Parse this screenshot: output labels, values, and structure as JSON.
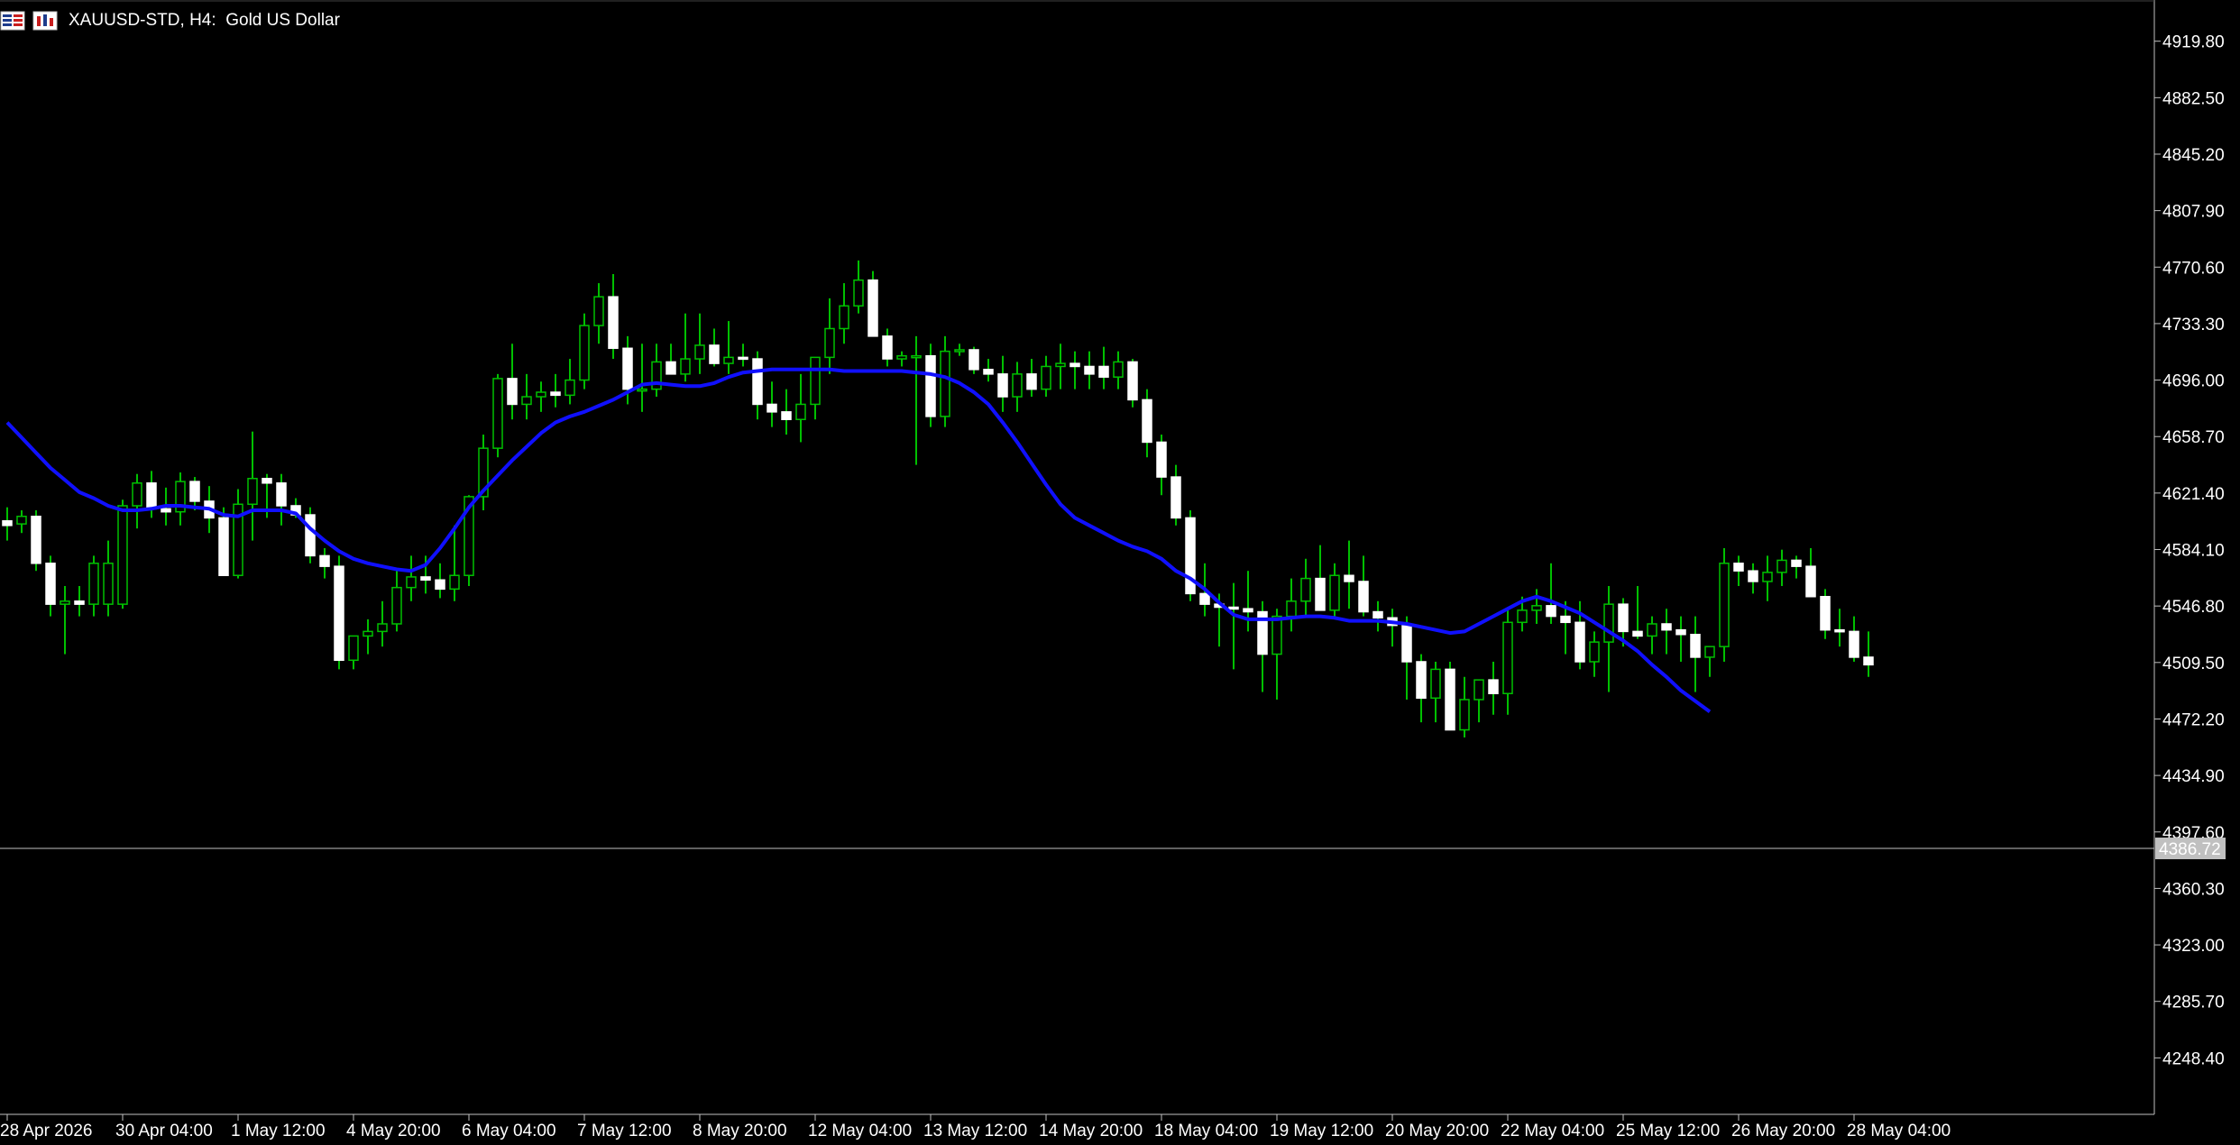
{
  "window": {
    "symbol": "XAUUSD-STD",
    "timeframe": "H4:",
    "description": "Gold US Dollar"
  },
  "icons": {
    "menu": "window-menu-icon",
    "chart": "chart-type-icon"
  },
  "colors": {
    "background": "#000000",
    "axis": "#c0c0c0",
    "bull_candle_body": "#000000",
    "bear_candle_body": "#ffffff",
    "wick": "#00c000",
    "ma_line": "#1010ff",
    "price_line": "#808080",
    "price_label_bg": "#c0c0c0",
    "text": "#ffffff"
  },
  "current_price": {
    "value": 4386.72,
    "label": "4386.72"
  },
  "chart_data": {
    "type": "candlestick",
    "symbol": "XAUUSD-STD",
    "timeframe": "H4",
    "ylim": [
      4211.1,
      4947.0
    ],
    "y_ticks": [
      "4919.80",
      "4882.50",
      "4845.20",
      "4807.90",
      "4770.60",
      "4733.30",
      "4696.00",
      "4658.70",
      "4621.40",
      "4584.10",
      "4546.80",
      "4509.50",
      "4472.20",
      "4434.90",
      "4397.60",
      "4360.30",
      "4323.00",
      "4285.70",
      "4248.40"
    ],
    "x_labels": [
      "28 Apr 2026",
      "30 Apr 04:00",
      "1 May 12:00",
      "4 May 20:00",
      "6 May 04:00",
      "7 May 12:00",
      "8 May 20:00",
      "12 May 04:00",
      "13 May 12:00",
      "14 May 20:00",
      "18 May 04:00",
      "19 May 12:00",
      "20 May 20:00",
      "22 May 04:00",
      "25 May 12:00",
      "26 May 20:00",
      "28 May 04:00"
    ],
    "x_label_bar_index": [
      0,
      8,
      16,
      24,
      32,
      40,
      48,
      56,
      64,
      72,
      80,
      88,
      96,
      104,
      112,
      120,
      128
    ],
    "candles": [
      [
        4603,
        4612,
        4590,
        4600
      ],
      [
        4601,
        4610,
        4595,
        4606
      ],
      [
        4606,
        4610,
        4570,
        4575
      ],
      [
        4575,
        4580,
        4540,
        4548
      ],
      [
        4548,
        4560,
        4515,
        4550
      ],
      [
        4550,
        4560,
        4540,
        4548
      ],
      [
        4548,
        4580,
        4540,
        4575
      ],
      [
        4548,
        4590,
        4540,
        4575
      ],
      [
        4548,
        4617,
        4545,
        4613
      ],
      [
        4613,
        4634,
        4598,
        4628
      ],
      [
        4628,
        4636,
        4605,
        4611
      ],
      [
        4611,
        4625,
        4600,
        4609
      ],
      [
        4609,
        4635,
        4600,
        4629
      ],
      [
        4629,
        4632,
        4610,
        4616
      ],
      [
        4616,
        4626,
        4595,
        4605
      ],
      [
        4605,
        4612,
        4570,
        4567
      ],
      [
        4567,
        4624,
        4565,
        4614
      ],
      [
        4614,
        4662,
        4590,
        4631
      ],
      [
        4631,
        4634,
        4605,
        4628
      ],
      [
        4628,
        4634,
        4600,
        4613
      ],
      [
        4613,
        4618,
        4605,
        4607
      ],
      [
        4607,
        4612,
        4575,
        4580
      ],
      [
        4580,
        4585,
        4565,
        4573
      ],
      [
        4573,
        4580,
        4505,
        4511
      ],
      [
        4511,
        4520,
        4505,
        4527
      ],
      [
        4527,
        4538,
        4515,
        4530
      ],
      [
        4530,
        4550,
        4520,
        4535
      ],
      [
        4535,
        4570,
        4530,
        4559
      ],
      [
        4559,
        4580,
        4550,
        4566
      ],
      [
        4566,
        4580,
        4555,
        4564
      ],
      [
        4564,
        4575,
        4552,
        4558
      ],
      [
        4558,
        4600,
        4550,
        4567
      ],
      [
        4567,
        4620,
        4560,
        4619
      ],
      [
        4619,
        4660,
        4610,
        4651
      ],
      [
        4651,
        4700,
        4645,
        4697
      ],
      [
        4697,
        4720,
        4670,
        4680
      ],
      [
        4680,
        4700,
        4670,
        4685
      ],
      [
        4685,
        4695,
        4675,
        4688
      ],
      [
        4688,
        4700,
        4678,
        4686
      ],
      [
        4686,
        4710,
        4680,
        4696
      ],
      [
        4696,
        4740,
        4690,
        4732
      ],
      [
        4732,
        4760,
        4720,
        4751
      ],
      [
        4751,
        4766,
        4710,
        4717
      ],
      [
        4717,
        4725,
        4680,
        4690
      ],
      [
        4690,
        4720,
        4675,
        4690
      ],
      [
        4690,
        4720,
        4685,
        4708
      ],
      [
        4708,
        4720,
        4700,
        4700
      ],
      [
        4700,
        4740,
        4695,
        4710
      ],
      [
        4710,
        4740,
        4700,
        4719
      ],
      [
        4719,
        4730,
        4705,
        4707
      ],
      [
        4707,
        4735,
        4700,
        4711
      ],
      [
        4711,
        4720,
        4705,
        4710
      ],
      [
        4710,
        4715,
        4670,
        4680
      ],
      [
        4680,
        4695,
        4665,
        4675
      ],
      [
        4675,
        4690,
        4660,
        4670
      ],
      [
        4670,
        4700,
        4655,
        4680
      ],
      [
        4680,
        4700,
        4670,
        4711
      ],
      [
        4711,
        4750,
        4700,
        4730
      ],
      [
        4730,
        4760,
        4720,
        4745
      ],
      [
        4745,
        4775,
        4740,
        4762
      ],
      [
        4762,
        4768,
        4725,
        4725
      ],
      [
        4725,
        4730,
        4705,
        4710
      ],
      [
        4710,
        4715,
        4705,
        4712
      ],
      [
        4712,
        4725,
        4640,
        4712
      ],
      [
        4712,
        4720,
        4665,
        4672
      ],
      [
        4672,
        4725,
        4665,
        4715
      ],
      [
        4715,
        4720,
        4712,
        4716
      ],
      [
        4716,
        4718,
        4700,
        4703
      ],
      [
        4703,
        4710,
        4695,
        4700
      ],
      [
        4700,
        4712,
        4675,
        4685
      ],
      [
        4685,
        4708,
        4675,
        4700
      ],
      [
        4700,
        4710,
        4685,
        4690
      ],
      [
        4690,
        4712,
        4685,
        4705
      ],
      [
        4705,
        4720,
        4690,
        4707
      ],
      [
        4707,
        4715,
        4690,
        4705
      ],
      [
        4705,
        4715,
        4690,
        4700
      ],
      [
        4705,
        4718,
        4690,
        4698
      ],
      [
        4698,
        4715,
        4690,
        4708
      ],
      [
        4708,
        4710,
        4678,
        4683
      ],
      [
        4683,
        4690,
        4645,
        4655
      ],
      [
        4655,
        4660,
        4620,
        4632
      ],
      [
        4632,
        4640,
        4600,
        4605
      ],
      [
        4605,
        4610,
        4550,
        4555
      ],
      [
        4555,
        4575,
        4540,
        4548
      ],
      [
        4548,
        4555,
        4520,
        4546
      ],
      [
        4546,
        4562,
        4505,
        4545
      ],
      [
        4545,
        4570,
        4530,
        4543
      ],
      [
        4543,
        4550,
        4490,
        4515
      ],
      [
        4515,
        4545,
        4485,
        4540
      ],
      [
        4540,
        4565,
        4530,
        4550
      ],
      [
        4550,
        4578,
        4540,
        4565
      ],
      [
        4565,
        4587,
        4545,
        4544
      ],
      [
        4544,
        4575,
        4538,
        4567
      ],
      [
        4567,
        4590,
        4545,
        4563
      ],
      [
        4563,
        4580,
        4540,
        4543
      ],
      [
        4543,
        4550,
        4530,
        4539
      ],
      [
        4539,
        4545,
        4520,
        4534
      ],
      [
        4534,
        4540,
        4485,
        4510
      ],
      [
        4510,
        4515,
        4470,
        4486
      ],
      [
        4486,
        4510,
        4470,
        4505
      ],
      [
        4505,
        4510,
        4475,
        4465
      ],
      [
        4465,
        4500,
        4460,
        4485
      ],
      [
        4485,
        4495,
        4470,
        4498
      ],
      [
        4498,
        4510,
        4475,
        4489
      ],
      [
        4489,
        4545,
        4475,
        4536
      ],
      [
        4536,
        4553,
        4530,
        4544
      ],
      [
        4544,
        4558,
        4535,
        4547
      ],
      [
        4547,
        4575,
        4535,
        4540
      ],
      [
        4540,
        4550,
        4515,
        4536
      ],
      [
        4536,
        4550,
        4505,
        4510
      ],
      [
        4510,
        4530,
        4500,
        4523
      ],
      [
        4523,
        4560,
        4490,
        4548
      ],
      [
        4548,
        4552,
        4520,
        4530
      ],
      [
        4530,
        4560,
        4525,
        4527
      ],
      [
        4527,
        4540,
        4515,
        4535
      ],
      [
        4535,
        4545,
        4515,
        4531
      ],
      [
        4531,
        4540,
        4510,
        4528
      ],
      [
        4528,
        4540,
        4490,
        4513
      ],
      [
        4513,
        4520,
        4500,
        4520
      ],
      [
        4520,
        4585,
        4510,
        4575
      ],
      [
        4575,
        4580,
        4560,
        4570
      ],
      [
        4570,
        4575,
        4555,
        4563
      ],
      [
        4563,
        4580,
        4550,
        4569
      ],
      [
        4569,
        4584,
        4560,
        4577
      ],
      [
        4577,
        4580,
        4565,
        4573
      ],
      [
        4573,
        4585,
        4555,
        4553
      ],
      [
        4553,
        4558,
        4525,
        4531
      ],
      [
        4531,
        4545,
        4520,
        4530
      ],
      [
        4530,
        4540,
        4510,
        4513
      ],
      [
        4513,
        4530,
        4500,
        4508
      ]
    ],
    "ma": {
      "name": "",
      "values": [
        4668,
        4658,
        4648,
        4638,
        4630,
        4622,
        4618,
        4613,
        4610,
        4610,
        4611,
        4613,
        4613,
        4612,
        4611,
        4607,
        4606,
        4610,
        4610,
        4610,
        4608,
        4598,
        4590,
        4583,
        4578,
        4575,
        4573,
        4571,
        4570,
        4574,
        4585,
        4598,
        4612,
        4623,
        4633,
        4643,
        4652,
        4661,
        4668,
        4672,
        4675,
        4679,
        4683,
        4688,
        4693,
        4694,
        4693,
        4692,
        4692,
        4694,
        4698,
        4701,
        4702,
        4703,
        4703,
        4703,
        4703,
        4703,
        4702,
        4702,
        4702,
        4702,
        4702,
        4701,
        4700,
        4698,
        4694,
        4688,
        4680,
        4668,
        4655,
        4641,
        4627,
        4614,
        4605,
        4600,
        4595,
        4590,
        4586,
        4583,
        4578,
        4570,
        4565,
        4558,
        4549,
        4541,
        4538,
        4538,
        4538,
        4539,
        4540,
        4540,
        4539,
        4537,
        4537,
        4537,
        4536,
        4535,
        4533,
        4531,
        4529,
        4530,
        4535,
        4540,
        4545,
        4550,
        4553,
        4550,
        4546,
        4542,
        4536,
        4530,
        4524,
        4517,
        4508,
        4500,
        4491,
        4484,
        4477
      ]
    }
  }
}
